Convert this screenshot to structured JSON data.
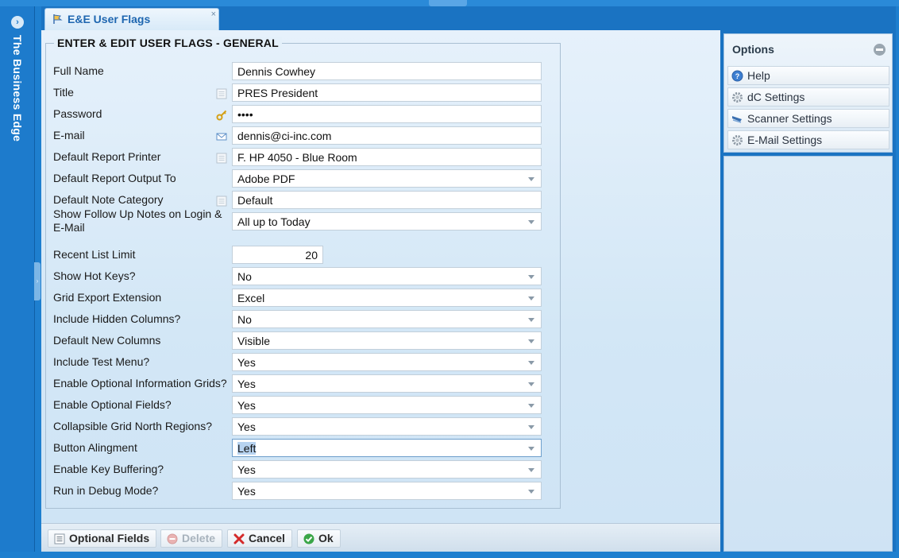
{
  "rail": {
    "title": "The Business Edge"
  },
  "tab": {
    "title": "E&E User Flags",
    "close": "×"
  },
  "form": {
    "legend": "ENTER & EDIT USER FLAGS - GENERAL",
    "fields": [
      {
        "label": "Full Name",
        "value": "Dennis Cowhey",
        "type": "text",
        "icon": ""
      },
      {
        "label": "Title",
        "value": "PRES  President",
        "type": "text",
        "icon": "list-icon"
      },
      {
        "label": "Password",
        "value": "••••",
        "type": "password",
        "icon": "key-icon"
      },
      {
        "label": "E-mail",
        "value": "dennis@ci-inc.com",
        "type": "text",
        "icon": "envelope-icon"
      },
      {
        "label": "Default Report Printer",
        "value": "F. HP 4050 - Blue Room",
        "type": "text",
        "icon": "list-icon"
      },
      {
        "label": "Default Report Output To",
        "value": "Adobe PDF",
        "type": "select",
        "icon": ""
      },
      {
        "label": "Default Note Category",
        "value": "Default",
        "type": "text",
        "icon": "list-icon"
      },
      {
        "label": "Show Follow Up Notes on Login & E-Mail",
        "value": "All up to Today",
        "type": "select",
        "icon": ""
      },
      {
        "label": "Recent List Limit",
        "value": "20",
        "type": "number",
        "icon": ""
      },
      {
        "label": "Show Hot Keys?",
        "value": "No",
        "type": "select",
        "icon": ""
      },
      {
        "label": "Grid Export Extension",
        "value": "Excel",
        "type": "select",
        "icon": ""
      },
      {
        "label": "Include Hidden Columns?",
        "value": "No",
        "type": "select",
        "icon": ""
      },
      {
        "label": "Default New Columns",
        "value": "Visible",
        "type": "select",
        "icon": ""
      },
      {
        "label": "Include Test Menu?",
        "value": "Yes",
        "type": "select",
        "icon": ""
      },
      {
        "label": "Enable Optional Information Grids?",
        "value": "Yes",
        "type": "select",
        "icon": ""
      },
      {
        "label": "Enable Optional Fields?",
        "value": "Yes",
        "type": "select",
        "icon": ""
      },
      {
        "label": "Collapsible Grid North Regions?",
        "value": "Yes",
        "type": "select",
        "icon": ""
      },
      {
        "label": "Button Alingment",
        "value": "Left",
        "type": "select",
        "icon": "",
        "focused": true
      },
      {
        "label": "Enable Key Buffering?",
        "value": "Yes",
        "type": "select",
        "icon": ""
      },
      {
        "label": "Run in Debug Mode?",
        "value": "Yes",
        "type": "select",
        "icon": ""
      }
    ]
  },
  "footer": {
    "optional_fields": "Optional Fields",
    "delete": "Delete",
    "cancel": "Cancel",
    "ok": "Ok"
  },
  "options": {
    "title": "Options",
    "items": [
      {
        "label": "Help",
        "icon": "help-icon"
      },
      {
        "label": "dC Settings",
        "icon": "gear-icon"
      },
      {
        "label": "Scanner Settings",
        "icon": "scanner-icon"
      },
      {
        "label": "E-Mail Settings",
        "icon": "gear-icon"
      }
    ]
  }
}
